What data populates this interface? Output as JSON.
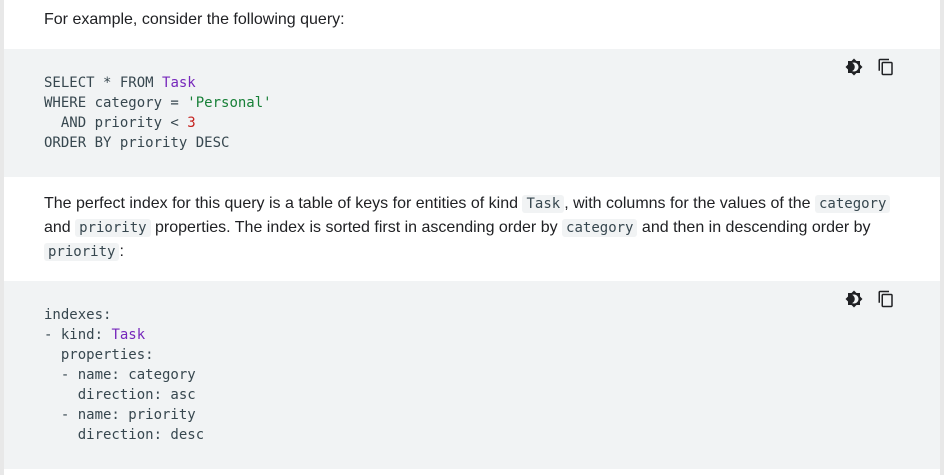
{
  "intro_text": "For example, consider the following query:",
  "code_block_1": {
    "lines": [
      {
        "parts": [
          {
            "t": "SELECT * FROM ",
            "c": "plain"
          },
          {
            "t": "Task",
            "c": "type"
          }
        ]
      },
      {
        "parts": [
          {
            "t": "WHERE category = ",
            "c": "plain"
          },
          {
            "t": "'Personal'",
            "c": "str"
          }
        ]
      },
      {
        "parts": [
          {
            "t": "  AND priority < ",
            "c": "plain"
          },
          {
            "t": "3",
            "c": "num"
          }
        ]
      },
      {
        "parts": [
          {
            "t": "ORDER BY priority DESC",
            "c": "plain"
          }
        ]
      }
    ]
  },
  "paragraph": [
    {
      "t": "The perfect index for this query is a table of keys for entities of kind ",
      "code": false
    },
    {
      "t": "Task",
      "code": true
    },
    {
      "t": ", with columns for the values of the ",
      "code": false
    },
    {
      "t": "category",
      "code": true
    },
    {
      "t": " and ",
      "code": false
    },
    {
      "t": "priority",
      "code": true
    },
    {
      "t": " properties. The index is sorted first in ascending order by ",
      "code": false
    },
    {
      "t": "category",
      "code": true
    },
    {
      "t": " and then in descending order by ",
      "code": false
    },
    {
      "t": "priority",
      "code": true
    },
    {
      "t": ":",
      "code": false
    }
  ],
  "code_block_2": {
    "lines": [
      {
        "parts": [
          {
            "t": "indexes:",
            "c": "plain"
          }
        ]
      },
      {
        "parts": [
          {
            "t": "- kind: ",
            "c": "plain"
          },
          {
            "t": "Task",
            "c": "type"
          }
        ]
      },
      {
        "parts": [
          {
            "t": "  properties:",
            "c": "plain"
          }
        ]
      },
      {
        "parts": [
          {
            "t": "  - name: category",
            "c": "plain"
          }
        ]
      },
      {
        "parts": [
          {
            "t": "    direction: asc",
            "c": "plain"
          }
        ]
      },
      {
        "parts": [
          {
            "t": "  - name: priority",
            "c": "plain"
          }
        ]
      },
      {
        "parts": [
          {
            "t": "    direction: desc",
            "c": "plain"
          }
        ]
      }
    ]
  },
  "icons": {
    "theme_toggle": "dark-mode-icon",
    "copy": "copy-icon"
  },
  "colors": {
    "code_background": "#f1f3f4",
    "type_keyword": "#7627bb",
    "string": "#188038",
    "number": "#c5221f"
  }
}
